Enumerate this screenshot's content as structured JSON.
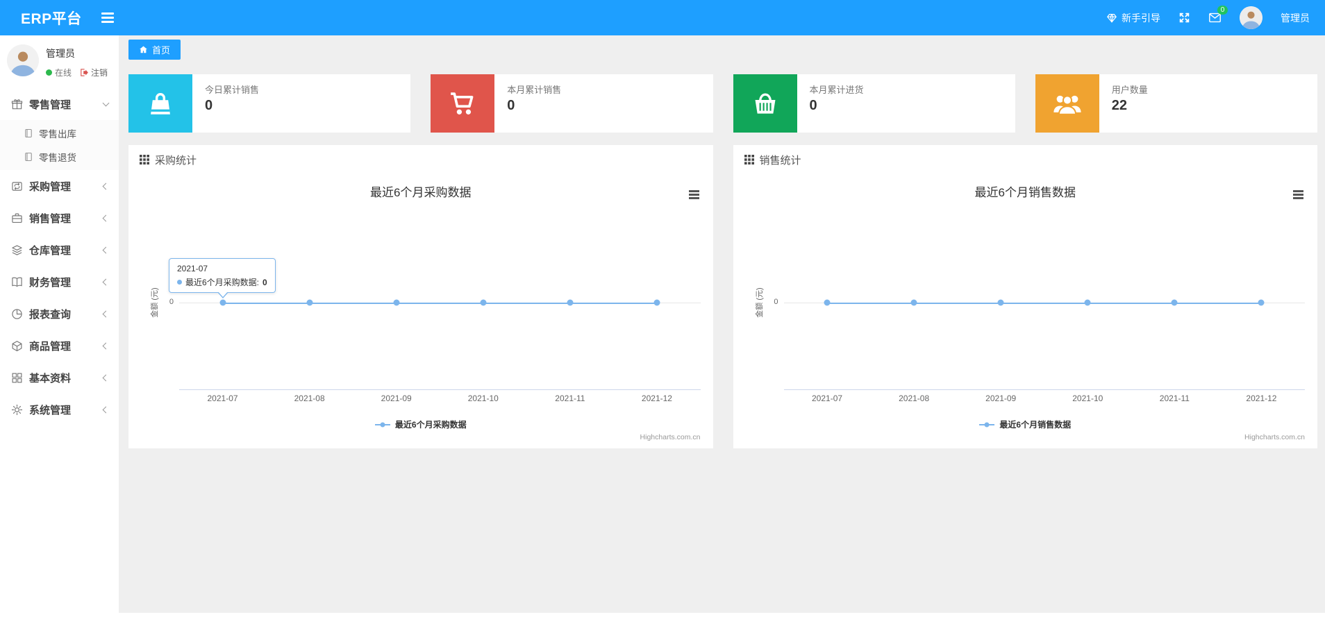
{
  "colors": {
    "accent_blue": "#1E9FFF",
    "badge_green": "#22c35e",
    "online_green": "#2db94d",
    "logout_red": "#d9534f",
    "chart_line": "#7cb5ec"
  },
  "navbar": {
    "brand": "ERP平台",
    "guide_label": "新手引导",
    "mail_badge": "0",
    "user_name": "管理员"
  },
  "sidebar": {
    "user": {
      "name": "管理员",
      "status_label": "在线",
      "logout_label": "注销"
    },
    "menu": [
      {
        "label": "零售管理",
        "icon": "gift-icon",
        "expanded": true,
        "children": [
          {
            "label": "零售出库",
            "icon": "journal-icon"
          },
          {
            "label": "零售退货",
            "icon": "journal-icon"
          }
        ]
      },
      {
        "label": "采购管理",
        "icon": "repeat-icon"
      },
      {
        "label": "销售管理",
        "icon": "briefcase-icon"
      },
      {
        "label": "仓库管理",
        "icon": "layers-icon"
      },
      {
        "label": "财务管理",
        "icon": "open-book-icon"
      },
      {
        "label": "报表查询",
        "icon": "pie-chart-icon"
      },
      {
        "label": "商品管理",
        "icon": "box-icon"
      },
      {
        "label": "基本资料",
        "icon": "grid-icon"
      },
      {
        "label": "系统管理",
        "icon": "gear-icon"
      }
    ]
  },
  "tabs": [
    {
      "label": "首页",
      "icon": "home-icon",
      "active": true
    }
  ],
  "stat_cards": [
    {
      "label": "今日累计销售",
      "value": "0",
      "color": "#23c2e8",
      "icon": "shopping-bag-icon"
    },
    {
      "label": "本月累计销售",
      "value": "0",
      "color": "#e0554b",
      "icon": "cart-icon"
    },
    {
      "label": "本月累计进货",
      "value": "0",
      "color": "#11a659",
      "icon": "basket-icon"
    },
    {
      "label": "用户数量",
      "value": "22",
      "color": "#f0a330",
      "icon": "users-icon"
    }
  ],
  "panels": [
    {
      "title": "采购统计",
      "icon": "th-grid-icon"
    },
    {
      "title": "销售统计",
      "icon": "th-grid-icon"
    }
  ],
  "chart_data": [
    {
      "type": "line",
      "title": "最近6个月采购数据",
      "x": [
        "2021-07",
        "2021-08",
        "2021-09",
        "2021-10",
        "2021-11",
        "2021-12"
      ],
      "series": [
        {
          "name": "最近6个月采购数据",
          "values": [
            0,
            0,
            0,
            0,
            0,
            0
          ],
          "color": "#7cb5ec"
        }
      ],
      "ylabel": "金额 (元)",
      "yticks": [
        "0"
      ],
      "grid": true,
      "legend_position": "bottom",
      "credit": "Highcharts.com.cn",
      "tooltip": {
        "header": "2021-07",
        "series": "最近6个月采购数据: ",
        "value": "0"
      }
    },
    {
      "type": "line",
      "title": "最近6个月销售数据",
      "x": [
        "2021-07",
        "2021-08",
        "2021-09",
        "2021-10",
        "2021-11",
        "2021-12"
      ],
      "series": [
        {
          "name": "最近6个月销售数据",
          "values": [
            0,
            0,
            0,
            0,
            0,
            0
          ],
          "color": "#7cb5ec"
        }
      ],
      "ylabel": "金额 (元)",
      "yticks": [
        "0"
      ],
      "grid": true,
      "legend_position": "bottom",
      "credit": "Highcharts.com.cn"
    }
  ]
}
